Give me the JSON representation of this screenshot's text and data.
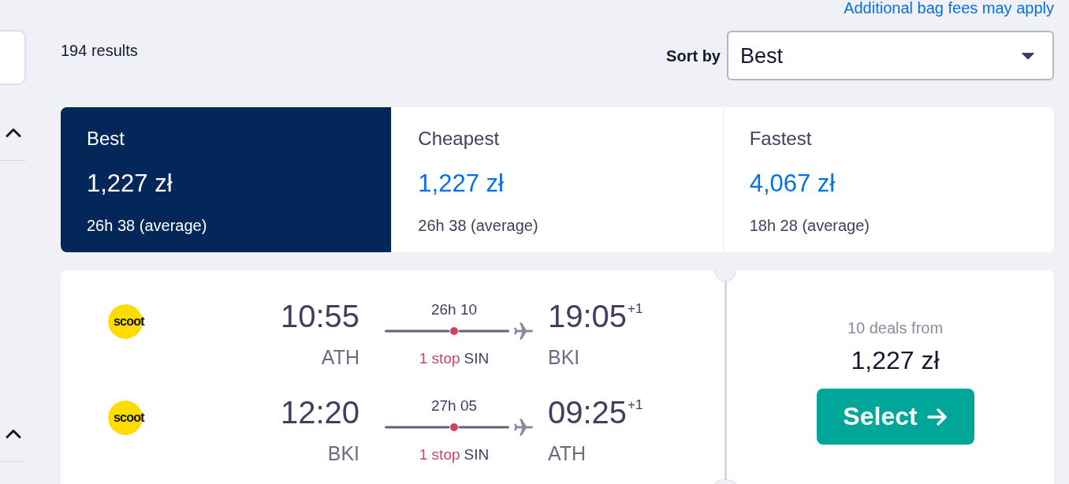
{
  "header": {
    "bag_fees_link": "Additional bag fees may apply",
    "results_count": "194 results",
    "sort": {
      "label": "Sort by",
      "value": "Best"
    }
  },
  "sidebar": {
    "sections": [
      {
        "expanded": true
      },
      {
        "expanded": true
      }
    ]
  },
  "sort_tabs": [
    {
      "label": "Best",
      "price": "1,227 zł",
      "duration": "26h 38 (average)",
      "selected": true
    },
    {
      "label": "Cheapest",
      "price": "1,227 zł",
      "duration": "26h 38 (average)",
      "selected": false
    },
    {
      "label": "Fastest",
      "price": "4,067 zł",
      "duration": "18h 28 (average)",
      "selected": false
    }
  ],
  "results": [
    {
      "legs": [
        {
          "airline_logo": "scoot",
          "depart_time": "10:55",
          "depart_airport": "ATH",
          "duration": "26h 10",
          "stops": "1 stop",
          "stop_airport": "SIN",
          "arrive_time": "19:05",
          "day_offset": "+1",
          "arrive_airport": "BKI"
        },
        {
          "airline_logo": "scoot",
          "depart_time": "12:20",
          "depart_airport": "BKI",
          "duration": "27h 05",
          "stops": "1 stop",
          "stop_airport": "SIN",
          "arrive_time": "09:25",
          "day_offset": "+1",
          "arrive_airport": "ATH"
        }
      ],
      "deals": "10 deals from",
      "price": "1,227 zł",
      "button": "Select"
    }
  ]
}
